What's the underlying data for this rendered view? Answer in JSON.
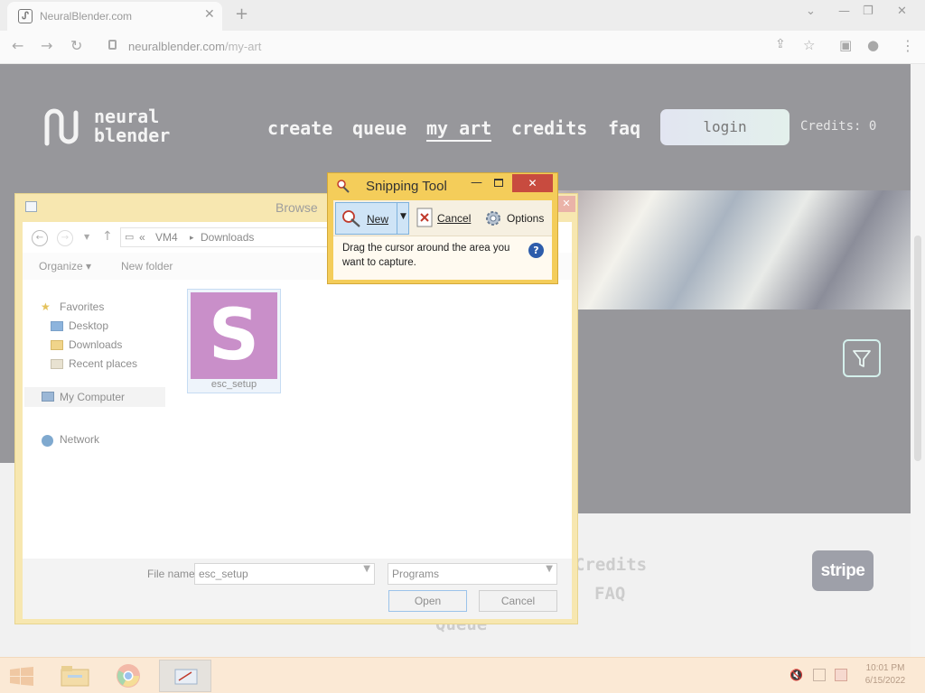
{
  "browser": {
    "tab_title": "NeuralBlender.com",
    "new_tab_symbol": "+",
    "url_host": "neuralblender.com",
    "url_path": "/my-art",
    "window_controls": [
      "⌄",
      "—",
      "❐",
      "✕"
    ]
  },
  "site": {
    "logo_line1": "neural",
    "logo_line2": "blender",
    "nav": [
      {
        "label": "create"
      },
      {
        "label": "queue"
      },
      {
        "label": "my art",
        "active": true
      },
      {
        "label": "credits"
      },
      {
        "label": "faq"
      }
    ],
    "login_label": "login",
    "credits_text": "Credits: 0",
    "footer_links": [
      "Credits",
      "FAQ",
      "Queue"
    ],
    "stripe_label": "stripe"
  },
  "browse_dialog": {
    "title": "Browse",
    "breadcrumb": [
      "«",
      "VM4",
      "▸",
      "Downloads"
    ],
    "organize_label": "Organize ▾",
    "new_folder_label": "New folder",
    "nav_pane": {
      "favorites": "Favorites",
      "desktop": "Desktop",
      "downloads": "Downloads",
      "recent_places": "Recent places",
      "my_computer": "My Computer",
      "network": "Network"
    },
    "file": {
      "name": "esc_setup",
      "thumb_letter": "S",
      "thumb_color": "#c98fc9"
    },
    "file_name_label": "File name:",
    "file_name_value": "esc_setup",
    "file_type_value": "Programs",
    "open_label": "Open",
    "cancel_label": "Cancel"
  },
  "snipping_tool": {
    "title": "Snipping Tool",
    "new_label": "New",
    "cancel_label": "Cancel",
    "options_label": "Options",
    "message": "Drag the cursor around the area you want to capture.",
    "help_symbol": "?"
  },
  "taskbar": {
    "time": "10:01 PM",
    "date": "6/15/2022"
  },
  "colors": {
    "page_bg": "#97979b",
    "dialog_frame": "#f7e7b0",
    "snip_frame": "#f4cd5a",
    "close_red": "#c84b3f"
  }
}
